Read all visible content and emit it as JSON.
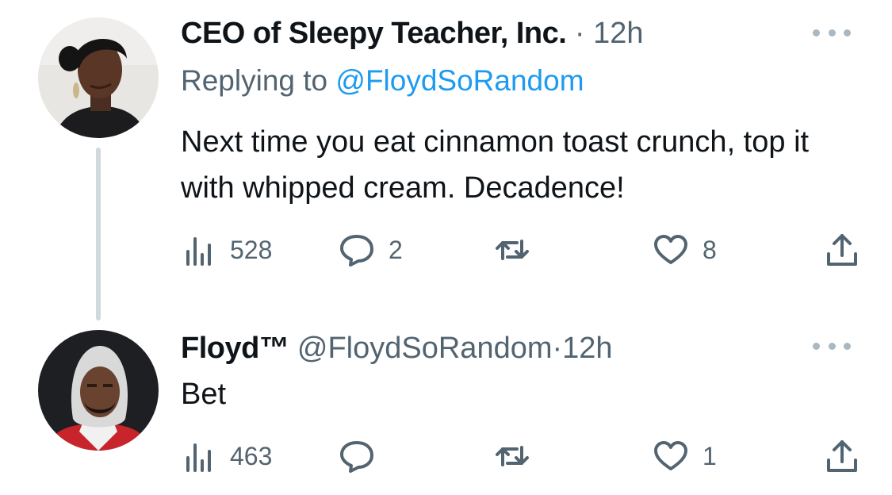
{
  "tweets": [
    {
      "display_name": "CEO of Sleepy Teacher, Inc.",
      "separator": "·",
      "time": "12h",
      "replying_prefix": "Replying to",
      "replying_handle": "@FloydSoRandom",
      "text": "Next time you eat cinnamon toast crunch, top it with whipped cream. Decadence!",
      "views": "528",
      "replies": "2",
      "retweets": "",
      "likes": "8",
      "icons": {
        "views": "views-chart-icon",
        "reply": "reply-bubble-icon",
        "retweet": "retweet-icon",
        "like": "heart-icon",
        "share": "share-upload-icon",
        "more": "more-dots-icon"
      }
    },
    {
      "display_name": "Floyd™",
      "handle": "@FloydSoRandom",
      "separator": "·",
      "time": "12h",
      "text": "Bet",
      "views": "463",
      "replies": "",
      "retweets": "",
      "likes": "1",
      "icons": {
        "views": "views-chart-icon",
        "reply": "reply-bubble-icon",
        "retweet": "retweet-icon",
        "like": "heart-icon",
        "share": "share-upload-icon",
        "more": "more-dots-icon"
      }
    }
  ],
  "colors": {
    "text": "#0f1419",
    "muted": "#536471",
    "link": "#1d9bf0",
    "thread_line": "#cfd9de"
  }
}
